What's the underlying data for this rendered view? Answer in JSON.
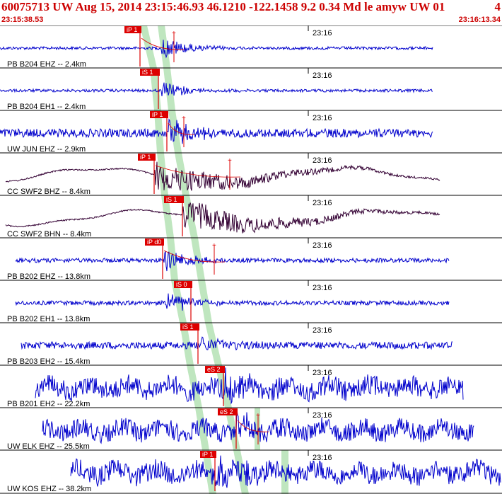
{
  "header": {
    "event_line": "60075713 UW Aug 15, 2014 23:15:46.93   46.1210 -122.1458  9.2 0.34 Md le amyw UW 01",
    "event_extra": "4",
    "start_time": "23:15:38.53",
    "end_time": "23:16:13.34"
  },
  "minute_label": "23:16",
  "colors": {
    "header_text": "#cc0000",
    "trace_blue": "#0000cc",
    "trace_dark": "#330033",
    "pick_red": "#dd0000",
    "window_green": "#bfe6bf"
  },
  "traces": [
    {
      "label": "PB B204 EHZ -- 2.4km",
      "pick": "iP 1",
      "color": "blue",
      "style": "quiet"
    },
    {
      "label": "PB B204 EH1 -- 2.4km",
      "pick": "iS 1",
      "color": "blue",
      "style": "quiet"
    },
    {
      "label": "UW JUN EHZ -- 2.9km",
      "pick": "iP 1",
      "color": "blue",
      "style": "medium"
    },
    {
      "label": "CC SWF2 BHZ -- 8.4km",
      "pick": "iP 1",
      "color": "dark",
      "style": "wave"
    },
    {
      "label": "CC SWF2 BHN -- 8.4km",
      "pick": "iS 1",
      "color": "dark",
      "style": "wave"
    },
    {
      "label": "PB B202 EHZ -- 13.8km",
      "pick": "iP d0",
      "color": "blue",
      "style": "medium"
    },
    {
      "label": "PB B202 EH1 -- 13.8km",
      "pick": "iS 0",
      "color": "blue",
      "style": "medium"
    },
    {
      "label": "PB B203 EH2 -- 15.4km",
      "pick": "iS 1",
      "color": "blue",
      "style": "medium"
    },
    {
      "label": "PB B201 EH2 -- 22.2km",
      "pick": "eS 2",
      "color": "blue",
      "style": "noisy"
    },
    {
      "label": "UW ELK EHZ -- 25.5km",
      "pick": "eS 2",
      "color": "blue",
      "style": "noisy"
    },
    {
      "label": "UW KOS EHZ -- 38.2km",
      "pick": "iP 1",
      "color": "blue",
      "style": "noisy"
    }
  ]
}
